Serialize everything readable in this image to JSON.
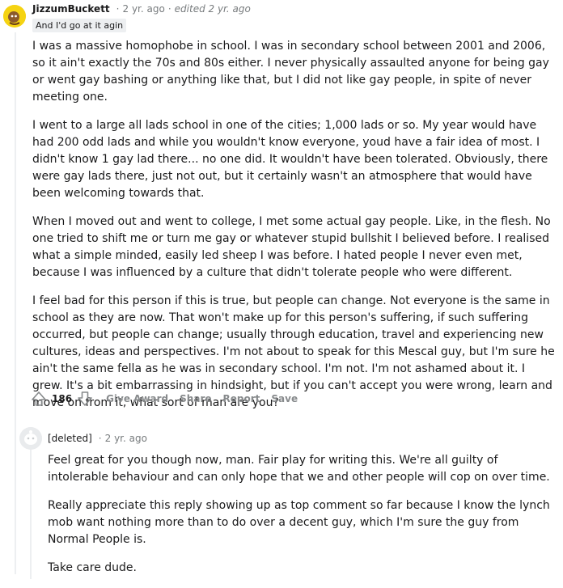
{
  "comment": {
    "author": "JizzumBuckett",
    "age": "2 yr. ago",
    "edited": "edited 2 yr. ago",
    "flair": "And I'd go at it agin",
    "paragraphs": [
      "I was a massive homophobe in school. I was in secondary school between 2001 and 2006, so it ain't exactly the 70s and 80s either. I never physically assaulted anyone for being gay or went gay bashing or anything like that, but I did not like gay people, in spite of never meeting one.",
      "I went to a large all lads school in one of the cities; 1,000 lads or so. My year would have had 200 odd lads and while you wouldn't know everyone, youd have a fair idea of most. I didn't know 1 gay lad there... no one did. It wouldn't have been tolerated. Obviously, there were gay lads there, just not out, but it certainly wasn't an atmosphere that would have been welcoming towards that.",
      "When I moved out and went to college, I met some actual gay people. Like, in the flesh. No one tried to shift me or turn me gay or whatever stupid bullshit I believed before. I realised what a simple minded, easily led sheep I was before. I hated people I never even met, because I was influenced by a culture that didn't tolerate people who were different.",
      "I feel bad for this person if this is true, but people can change. Not everyone is the same in school as they are now. That won't make up for this person's suffering, if such suffering occurred, but people can change; usually through education, travel and experiencing new cultures, ideas and perspectives. I'm not about to speak for this Mescal guy, but I'm sure he ain't the same fella as he was in secondary school. I'm not. I'm not ashamed about it. I grew. It's a bit embarrassing in hindsight, but if you can't accept you were wrong, learn and move on from it, what sort of man are you?"
    ],
    "score": "186",
    "actions": {
      "give_award": "Give Award",
      "share": "Share",
      "report": "Report",
      "save": "Save"
    }
  },
  "reply": {
    "author": "[deleted]",
    "age": "2 yr. ago",
    "paragraphs": [
      "Feel great for you though now, man. Fair play for writing this. We're all guilty of intolerable behaviour and can only hope that we and other people will cop on over time.",
      "Really appreciate this reply showing up as top comment so far because I know the lynch mob want nothing more than to do over a decent guy, which I'm sure the guy from Normal People is.",
      "Take care dude."
    ]
  },
  "icons": {
    "upvote": "upvote-arrow-icon",
    "downvote": "downvote-arrow-icon",
    "avatar_main": "snoo-avatar-icon",
    "avatar_deleted": "deleted-avatar-icon"
  },
  "colors": {
    "text": "#1a1a1b",
    "meta": "#787c7e",
    "action": "#878a8c",
    "avatar_yellow": "#f5d312",
    "flair_bg": "#edeff1"
  }
}
